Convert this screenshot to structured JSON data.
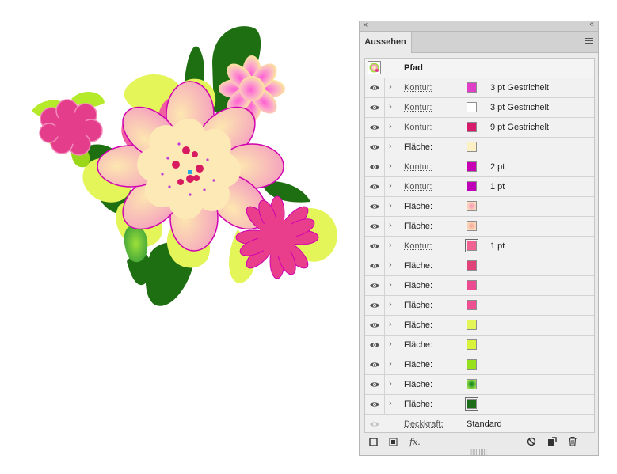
{
  "panel": {
    "tab_label": "Aussehen",
    "close_glyph": "×",
    "collapse_glyph": "‹‹",
    "object_title": "Pfad",
    "rows": [
      {
        "label": "Kontur:",
        "swatch": "#e040c8",
        "value": "3 pt Gestrichelt",
        "kind": "stroke"
      },
      {
        "label": "Kontur:",
        "swatch": "#ffffff",
        "value": "3 pt Gestrichelt",
        "kind": "stroke"
      },
      {
        "label": "Kontur:",
        "swatch": "#d81b6a",
        "value": "9 pt Gestrichelt",
        "kind": "stroke"
      },
      {
        "label": "Fläche:",
        "swatch": "#fdf0c4",
        "value": "",
        "kind": "fill"
      },
      {
        "label": "Kontur:",
        "swatch": "#c800b4",
        "value": "2 pt",
        "kind": "stroke"
      },
      {
        "label": "Kontur:",
        "swatch": "#c000b8",
        "value": "1 pt",
        "kind": "stroke"
      },
      {
        "label": "Fläche:",
        "swatch": "radial-pink",
        "value": "",
        "kind": "fill"
      },
      {
        "label": "Fläche:",
        "swatch": "radial-peach",
        "value": "",
        "kind": "fill"
      },
      {
        "label": "Kontur:",
        "swatch": "#f06292",
        "value": "1 pt",
        "kind": "stroke",
        "selected": true
      },
      {
        "label": "Fläche:",
        "swatch": "#e0437a",
        "value": "",
        "kind": "fill"
      },
      {
        "label": "Fläche:",
        "swatch": "#ec4b92",
        "value": "",
        "kind": "fill"
      },
      {
        "label": "Fläche:",
        "swatch": "#ee4f92",
        "value": "",
        "kind": "fill"
      },
      {
        "label": "Fläche:",
        "swatch": "#e4f55a",
        "value": "",
        "kind": "fill"
      },
      {
        "label": "Fläche:",
        "swatch": "#d9f33a",
        "value": "",
        "kind": "fill"
      },
      {
        "label": "Fläche:",
        "swatch": "#96e01e",
        "value": "",
        "kind": "fill"
      },
      {
        "label": "Fläche:",
        "swatch": "radial-green",
        "value": "",
        "kind": "fill"
      },
      {
        "label": "Fläche:",
        "swatch": "#1e6b1a",
        "value": "",
        "kind": "fill",
        "selected": true
      }
    ],
    "opacity_label": "Deckkraft:",
    "opacity_value": "Standard",
    "bottom_icons": [
      "new-stroke-icon",
      "new-fill-icon",
      "fx-icon",
      "clear-icon",
      "duplicate-icon",
      "trash-icon"
    ],
    "fx_label": "fx."
  },
  "colors": {
    "dark_green": "#1e6e12",
    "lime": "#e4f55a",
    "magenta": "#e43d8c",
    "cream": "#fdeab5"
  }
}
